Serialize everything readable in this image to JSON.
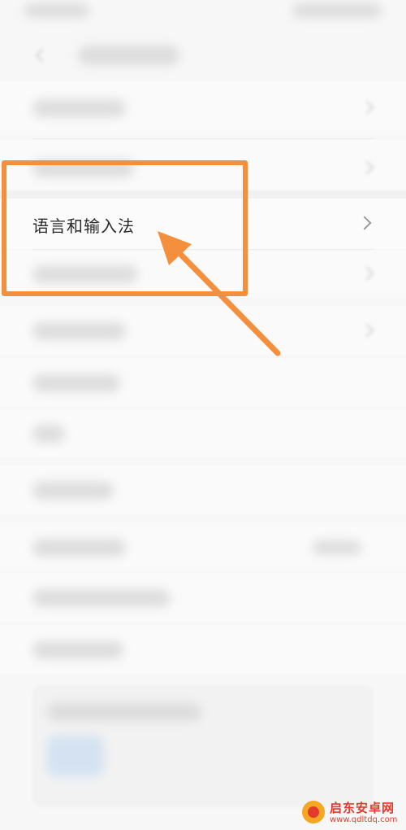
{
  "settings": {
    "language_input_label": "语言和输入法"
  },
  "annotation": {
    "highlight_color": "#f4903d",
    "arrow_color": "#f4903d"
  },
  "watermark": {
    "title": "启东安卓网",
    "url": "www.qdltdq.com"
  }
}
